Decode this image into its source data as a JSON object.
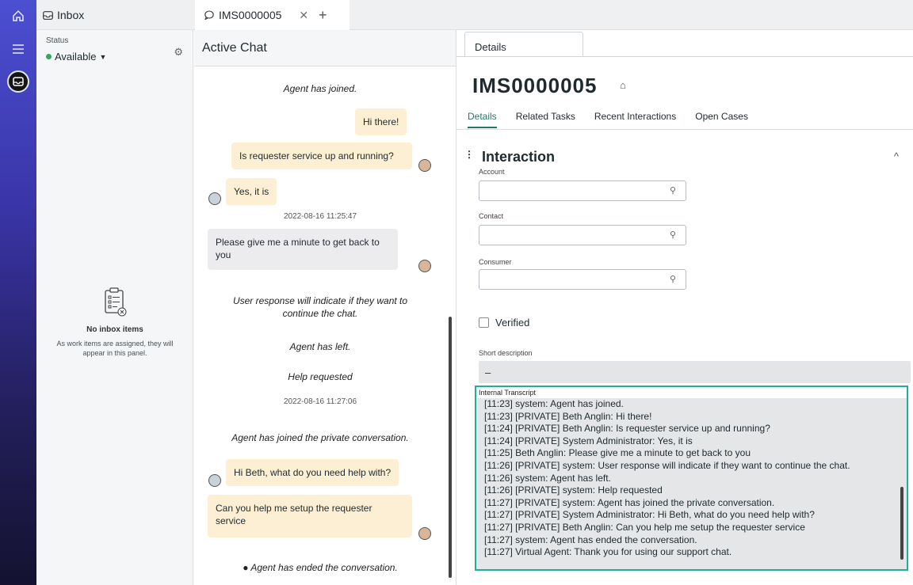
{
  "tabs": {
    "inbox": "Inbox",
    "chat": "IMS0000005"
  },
  "inbox": {
    "status_label": "Status",
    "status_value": "Available",
    "empty_title": "No inbox items",
    "empty_text": "As work items are assigned, they will appear in this panel."
  },
  "chat": {
    "title": "Active Chat",
    "messages": [
      {
        "kind": "system",
        "text": "Agent has joined."
      },
      {
        "kind": "bubble",
        "text": "Hi there!"
      },
      {
        "kind": "bubble",
        "text": "Is requester service up and running?"
      },
      {
        "kind": "bubble",
        "text": "Yes, it is"
      },
      {
        "kind": "timestamp",
        "text": "2022-08-16 11:25:47"
      },
      {
        "kind": "bubble",
        "text": "Please give me a minute to get back to you"
      },
      {
        "kind": "system",
        "text": "User response will indicate if they want to continue the chat."
      },
      {
        "kind": "system",
        "text": "Agent has left."
      },
      {
        "kind": "system",
        "text": "Help requested"
      },
      {
        "kind": "timestamp",
        "text": "2022-08-16 11:27:06"
      },
      {
        "kind": "system",
        "text": "Agent has joined the private conversation."
      },
      {
        "kind": "bubble",
        "text": "Hi Beth, what do you need help with?"
      },
      {
        "kind": "bubble",
        "text": "Can you help me setup the requester service"
      },
      {
        "kind": "system",
        "text": "Agent has ended the conversation."
      }
    ]
  },
  "details": {
    "tab": "Details",
    "record_id": "IMS0000005",
    "subtabs": [
      "Details",
      "Related Tasks",
      "Recent Interactions",
      "Open Cases"
    ],
    "section_title": "Interaction",
    "fields": {
      "account": "Account",
      "contact": "Contact",
      "consumer": "Consumer",
      "verified": "Verified",
      "short_description": "Short description",
      "short_description_value": "–",
      "internal_transcript": "Internal Transcript"
    },
    "transcript": [
      "[11:23] system: Agent has joined.",
      "[11:23] [PRIVATE] Beth Anglin: Hi there!",
      "[11:24] [PRIVATE] Beth Anglin: Is requester service up and running?",
      "[11:24] [PRIVATE] System Administrator: Yes, it is",
      "[11:25] Beth Anglin: Please give me a minute to get back to you",
      "[11:26] [PRIVATE] system: User response will indicate if they want to continue the chat.",
      "[11:26] system: Agent has left.",
      "[11:26] [PRIVATE] system: Help requested",
      "[11:27] [PRIVATE] system: Agent has joined the private conversation.",
      "[11:27] [PRIVATE] System Administrator: Hi Beth, what do you need help with?",
      "[11:27] [PRIVATE] Beth Anglin: Can you help me setup the requester service",
      "[11:27] system: Agent has ended the conversation.",
      "[11:27] Virtual Agent: Thank you for using our support chat."
    ]
  }
}
